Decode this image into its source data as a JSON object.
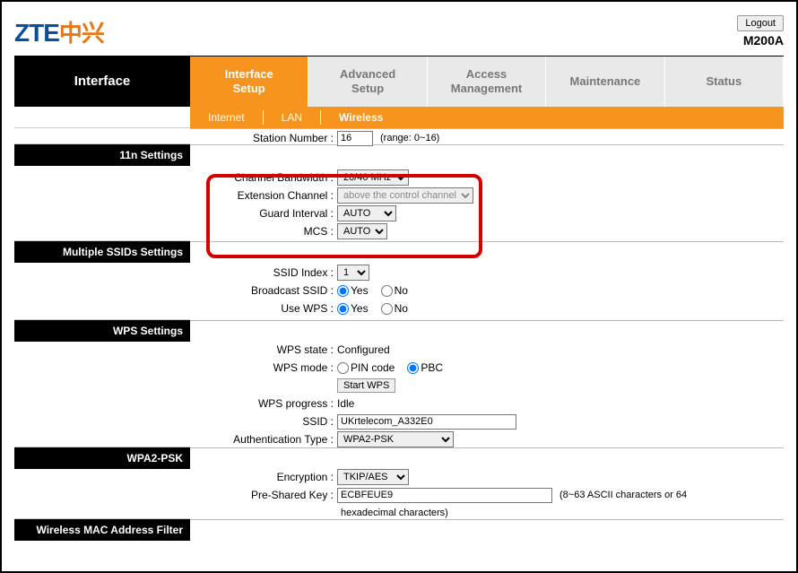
{
  "header": {
    "logo_latin": "ZTE",
    "logo_cjk": "中兴",
    "logout": "Logout",
    "model": "M200A"
  },
  "sidebar": {
    "title": "Interface",
    "sections": {
      "n11": "11n Settings",
      "ssids": "Multiple SSIDs Settings",
      "wps": "WPS Settings",
      "wpa2": "WPA2-PSK",
      "macfilter": "Wireless MAC Address Filter"
    }
  },
  "tabs": {
    "interface": {
      "l1": "Interface",
      "l2": "Setup"
    },
    "advanced": {
      "l1": "Advanced",
      "l2": "Setup"
    },
    "access": {
      "l1": "Access",
      "l2": "Management"
    },
    "maintenance": "Maintenance",
    "status": "Status"
  },
  "subtabs": {
    "internet": "Internet",
    "lan": "LAN",
    "wireless": "Wireless"
  },
  "fields": {
    "station_number": {
      "label": "Station Number :",
      "value": "16",
      "note": "(range: 0~16)"
    },
    "channel_bw": {
      "label": "Channel Bandwidth :",
      "value": "20/40 MHz"
    },
    "ext_channel": {
      "label": "Extension Channel :",
      "value": "above the control channel"
    },
    "guard": {
      "label": "Guard Interval :",
      "value": "AUTO"
    },
    "mcs": {
      "label": "MCS :",
      "value": "AUTO"
    },
    "ssid_index": {
      "label": "SSID Index :",
      "value": "1"
    },
    "broadcast": {
      "label": "Broadcast SSID :",
      "yes": "Yes",
      "no": "No"
    },
    "use_wps": {
      "label": "Use WPS :",
      "yes": "Yes",
      "no": "No"
    },
    "wps_state": {
      "label": "WPS state :",
      "value": "Configured"
    },
    "wps_mode": {
      "label": "WPS mode :",
      "pin": "PIN code",
      "pbc": "PBC"
    },
    "start_wps": "Start WPS",
    "wps_progress": {
      "label": "WPS progress :",
      "value": "Idle"
    },
    "ssid": {
      "label": "SSID :",
      "value": "UKrtelecom_A332E0"
    },
    "auth_type": {
      "label": "Authentication Type :",
      "value": "WPA2-PSK"
    },
    "encryption": {
      "label": "Encryption :",
      "value": "TKIP/AES"
    },
    "psk": {
      "label": "Pre-Shared Key :",
      "value": "ECBFEUE9",
      "note1": "(8~63 ASCII characters or 64",
      "note2": "hexadecimal characters)"
    }
  }
}
